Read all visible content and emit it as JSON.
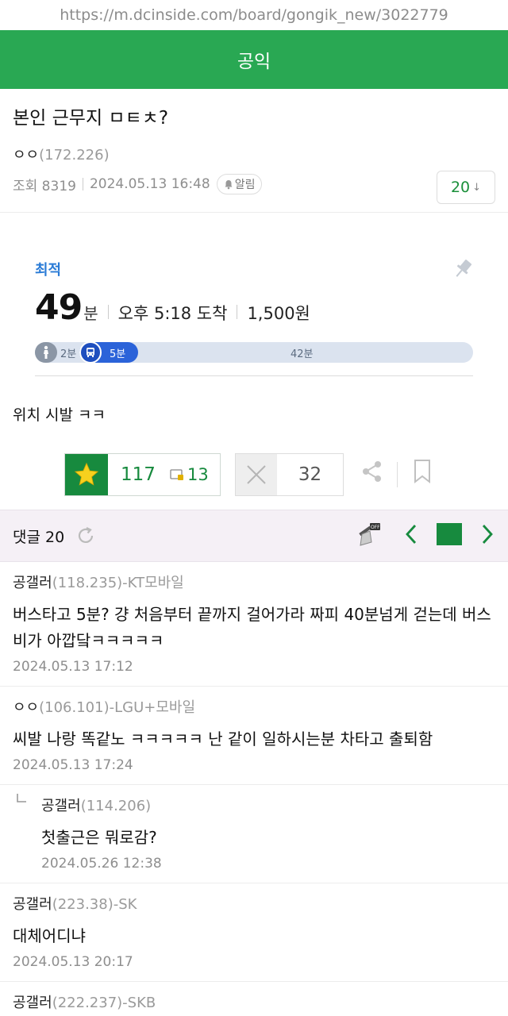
{
  "browser": {
    "url": "https://m.dcinside.com/board/gongik_new/3022779"
  },
  "header": {
    "title": "공익"
  },
  "post": {
    "title": "본인 근무지 ㅁㅌㅊ?",
    "author": "ㅇㅇ",
    "author_ip": "(172.226)",
    "views": "조회 8319",
    "date": "2024.05.13 16:48",
    "alarm_label": "알림",
    "comment_count": "20",
    "body": "위치 시발 ㅋㅋ"
  },
  "route_card": {
    "label": "최적",
    "minutes": "49",
    "minutes_unit": "분",
    "arrival": "오후 5:18 도착",
    "fare": "1,500원",
    "walk_label": "2분",
    "bus_label": "5분",
    "rest_label": "42분"
  },
  "actions": {
    "recommend_count": "117",
    "fix_recommend_count": "13",
    "nonrecommend_count": "32"
  },
  "comment_bar": {
    "label": "댓글 20"
  },
  "comments": [
    {
      "author": "공갤러",
      "ip": "(118.235)-KT모바일",
      "text": "버스타고 5분? 걍 처음부터 끝까지 걸어가라 짜피 40분넘게 걷는데 버스비가 아깝닼ㅋㅋㅋㅋㅋ",
      "date": "2024.05.13 17:12"
    },
    {
      "author": "ㅇㅇ",
      "ip": "(106.101)-LGU+모바일",
      "text": "씨발 나랑 똑같노 ㅋㅋㅋㅋㅋ 난 같이 일하시는분 차타고 출퇴함",
      "date": "2024.05.13 17:24"
    },
    {
      "author": "공갤러",
      "ip": "(114.206)",
      "text": "첫출근은 뭐로감?",
      "date": "2024.05.26 12:38"
    },
    {
      "author": "공갤러",
      "ip": "(223.38)-SK",
      "text": "대체어디냐",
      "date": "2024.05.13 20:17"
    },
    {
      "author": "공갤러",
      "ip": "(222.237)-SKB"
    }
  ],
  "colors": {
    "brand_green": "#29a853",
    "accent_green": "#178a3e",
    "bus_blue": "#2b63d9",
    "best_blue": "#2a7bd6"
  },
  "icons": [
    "pin-icon",
    "walk-icon",
    "bus-icon",
    "star-icon",
    "fix-icon",
    "x-icon",
    "share-icon",
    "bookmark-icon",
    "refresh-icon",
    "broom-off-icon",
    "chevron-left-icon",
    "chevron-right-icon",
    "bell-icon",
    "reply-arrow-icon"
  ]
}
